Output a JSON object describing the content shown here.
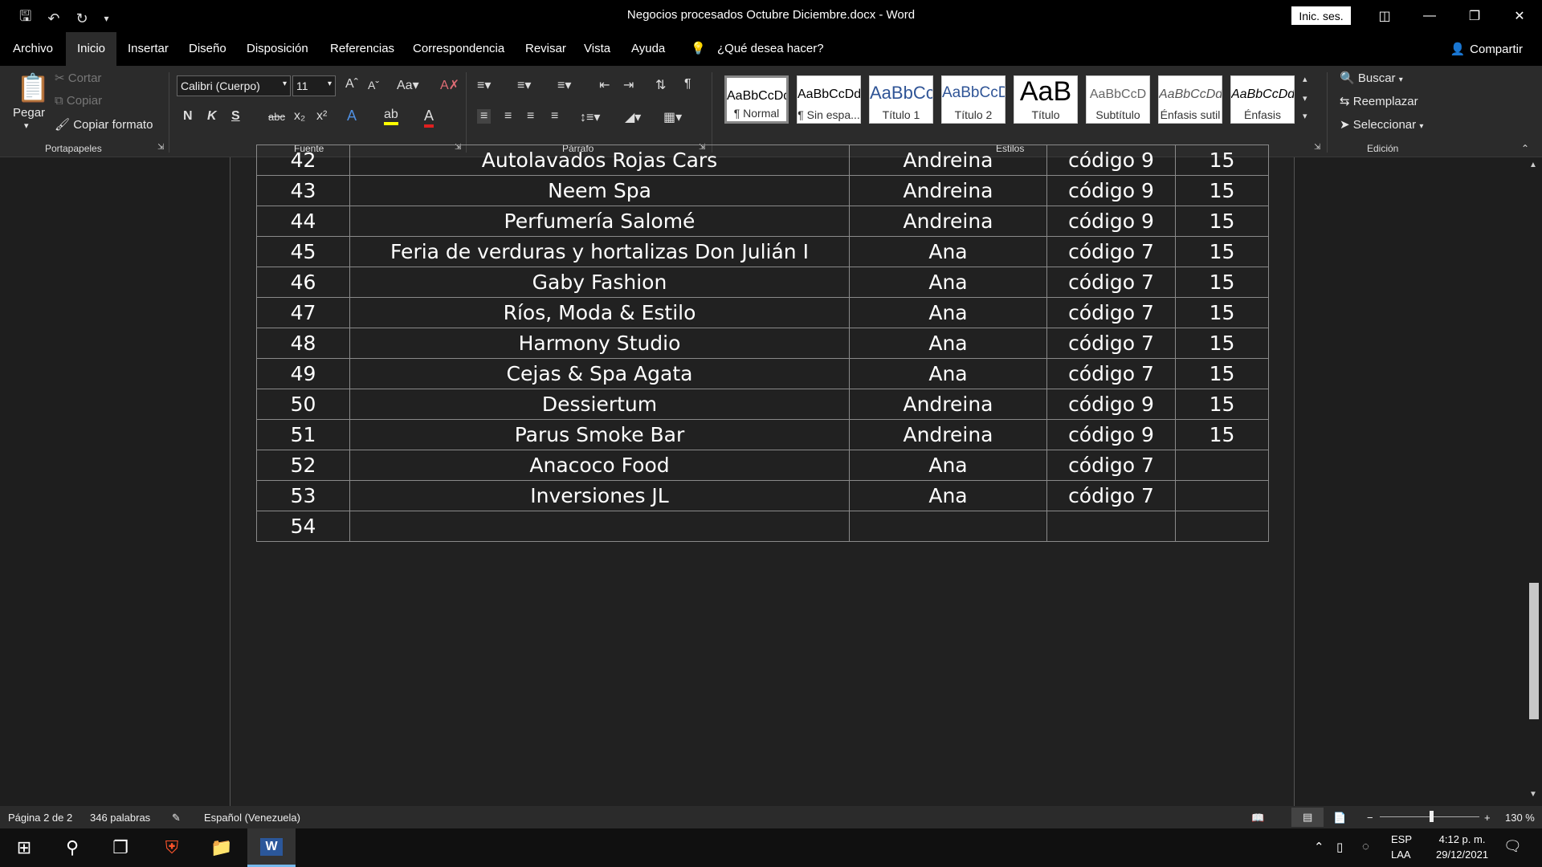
{
  "window": {
    "title": "Negocios procesados Octubre Diciembre.docx - Word",
    "sign_in": "Inic. ses."
  },
  "menu": {
    "tabs": [
      "Archivo",
      "Inicio",
      "Insertar",
      "Diseño",
      "Disposición",
      "Referencias",
      "Correspondencia",
      "Revisar",
      "Vista",
      "Ayuda"
    ],
    "active_tab": "Inicio",
    "tell_me": "¿Qué desea hacer?",
    "share": "Compartir"
  },
  "ribbon": {
    "clipboard": {
      "paste": "Pegar",
      "cut": "Cortar",
      "copy": "Copiar",
      "format_painter": "Copiar formato",
      "label": "Portapapeles"
    },
    "font": {
      "name": "Calibri (Cuerpo)",
      "size": "11",
      "label": "Fuente",
      "bold": "N",
      "italic": "K",
      "underline": "S",
      "strike": "abc"
    },
    "paragraph": {
      "label": "Párrafo"
    },
    "styles": {
      "label": "Estilos",
      "items": [
        {
          "preview": "AaBbCcDd",
          "name": "¶ Normal"
        },
        {
          "preview": "AaBbCcDd",
          "name": "¶ Sin espa..."
        },
        {
          "preview": "AaBbCc",
          "name": "Título 1"
        },
        {
          "preview": "AaBbCcD",
          "name": "Título 2"
        },
        {
          "preview": "AaB",
          "name": "Título"
        },
        {
          "preview": "AaBbCcD",
          "name": "Subtítulo"
        },
        {
          "preview": "AaBbCcDd",
          "name": "Énfasis sutil"
        },
        {
          "preview": "AaBbCcDd",
          "name": "Énfasis"
        }
      ]
    },
    "editing": {
      "label": "Edición",
      "find": "Buscar",
      "replace": "Reemplazar",
      "select": "Seleccionar"
    }
  },
  "table_rows": [
    {
      "n": "42",
      "name": "Autolavados Rojas Cars",
      "person": "Andreina",
      "code": "código 9",
      "value": "15"
    },
    {
      "n": "43",
      "name": "Neem Spa",
      "person": "Andreina",
      "code": "código 9",
      "value": "15"
    },
    {
      "n": "44",
      "name": "Perfumería Salomé",
      "person": "Andreina",
      "code": "código 9",
      "value": "15"
    },
    {
      "n": "45",
      "name": "Feria de verduras y hortalizas Don Julián I",
      "person": "Ana",
      "code": "código 7",
      "value": "15"
    },
    {
      "n": "46",
      "name": "Gaby Fashion",
      "person": "Ana",
      "code": "código 7",
      "value": "15"
    },
    {
      "n": "47",
      "name": "Ríos, Moda & Estilo",
      "person": "Ana",
      "code": "código 7",
      "value": "15"
    },
    {
      "n": "48",
      "name": "Harmony Studio",
      "person": "Ana",
      "code": "código 7",
      "value": "15"
    },
    {
      "n": "49",
      "name": "Cejas & Spa Agata",
      "person": "Ana",
      "code": "código 7",
      "value": "15"
    },
    {
      "n": "50",
      "name": "Dessiertum",
      "person": "Andreina",
      "code": "código 9",
      "value": "15"
    },
    {
      "n": "51",
      "name": "Parus Smoke Bar",
      "person": "Andreina",
      "code": "código 9",
      "value": "15"
    },
    {
      "n": "52",
      "name": "Anacoco Food",
      "person": "Ana",
      "code": "código 7",
      "value": ""
    },
    {
      "n": "53",
      "name": "Inversiones JL",
      "person": "Ana",
      "code": "código 7",
      "value": ""
    },
    {
      "n": "54",
      "name": "",
      "person": "",
      "code": "",
      "value": ""
    }
  ],
  "status": {
    "page": "Página 2 de 2",
    "words": "346 palabras",
    "language": "Español (Venezuela)",
    "zoom": "130 %"
  },
  "taskbar": {
    "lang1": "ESP",
    "lang2": "LAA",
    "time": "4:12 p. m.",
    "date": "29/12/2021"
  }
}
